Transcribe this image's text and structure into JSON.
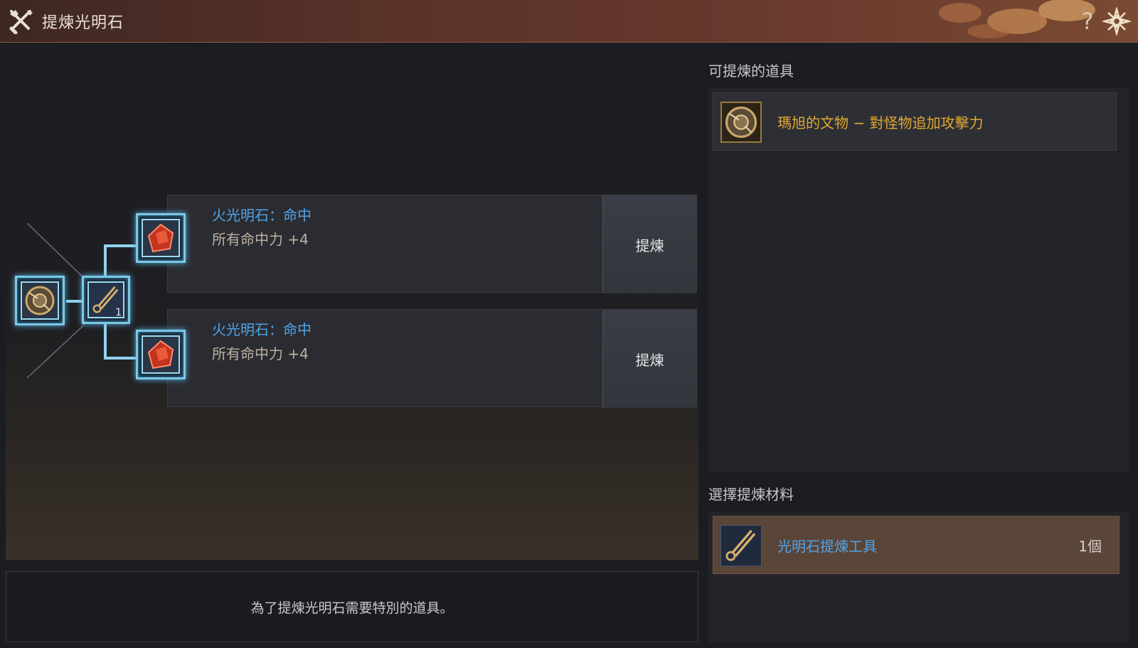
{
  "window": {
    "title": "提煉光明石",
    "help_label": "?"
  },
  "tree": {
    "source_item_icon": "relic-icon",
    "tool_icon": "refining-tool-icon",
    "tool_count": "1"
  },
  "results": [
    {
      "name": "火光明石：命中",
      "desc": "所有命中力 +4",
      "button": "提煉",
      "icon": "red-gem-icon"
    },
    {
      "name": "火光明石：命中",
      "desc": "所有命中力 +4",
      "button": "提煉",
      "icon": "red-gem-icon"
    }
  ],
  "message": "為了提煉光明石需要特別的道具。",
  "refinable": {
    "label": "可提煉的道具",
    "items": [
      {
        "name": "瑪旭的文物 − 對怪物追加攻擊力",
        "icon": "relic-icon"
      }
    ]
  },
  "materials": {
    "label": "選擇提煉材料",
    "items": [
      {
        "name": "光明石提煉工具",
        "count": "1個",
        "icon": "refining-tool-icon"
      }
    ]
  },
  "colors": {
    "title_bar": "#6a3a2e",
    "result_name": "#4fa3e8",
    "item_gold": "#e0a930",
    "slot_glow": "#7cc8e8",
    "material_bg": "#5a4539"
  }
}
